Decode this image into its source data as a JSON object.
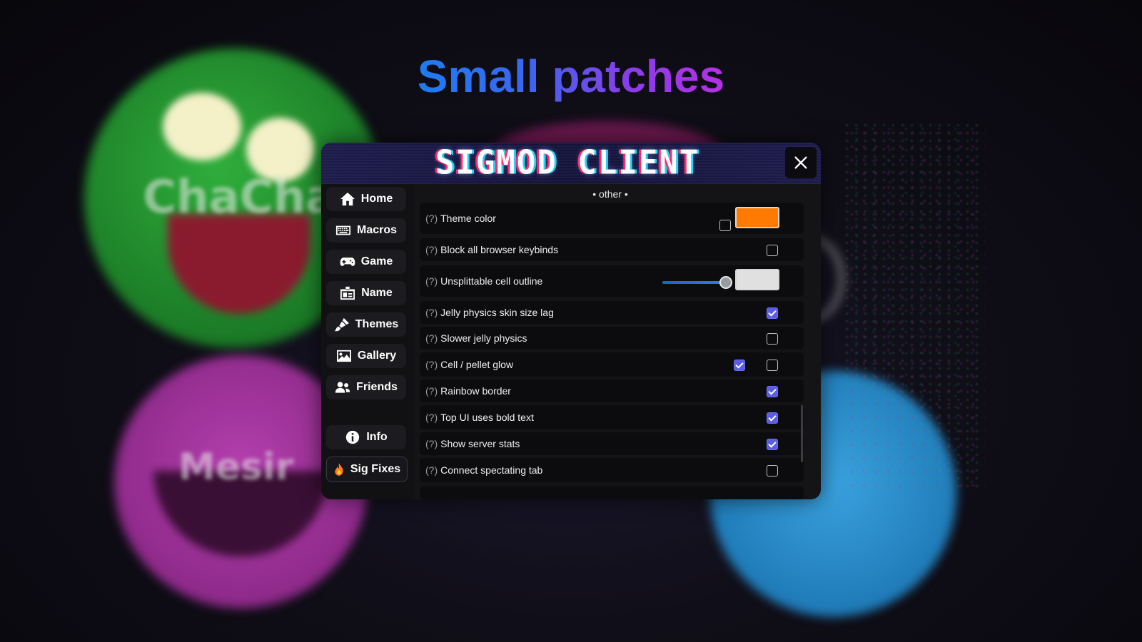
{
  "headline": "Small patches",
  "background_text": {
    "top_left": "ChaCha",
    "bottom_left": "Mesir"
  },
  "modal": {
    "logo_text": "SIGMOD CLIENT",
    "close_icon": "close-icon"
  },
  "sidebar": {
    "items": [
      {
        "label": "Home",
        "icon": "home-icon"
      },
      {
        "label": "Macros",
        "icon": "keyboard-icon"
      },
      {
        "label": "Game",
        "icon": "gamepad-icon"
      },
      {
        "label": "Name",
        "icon": "id-card-icon"
      },
      {
        "label": "Themes",
        "icon": "paint-brush-icon"
      },
      {
        "label": "Gallery",
        "icon": "image-icon"
      },
      {
        "label": "Friends",
        "icon": "users-icon"
      }
    ],
    "info": {
      "label": "Info",
      "icon": "info-icon"
    },
    "sig_fixes": {
      "label": "Sig Fixes",
      "icon": "fire-icon"
    }
  },
  "content": {
    "section_title": "• other •",
    "help_marker": "(?)",
    "settings": [
      {
        "label": "Theme color",
        "checkbox": false,
        "color": "#ff7a00"
      },
      {
        "label": "Block all browser keybinds",
        "checkbox": false
      },
      {
        "label": "Unsplittable cell outline",
        "slider_value": 0.99,
        "color": "#e0e0e0"
      },
      {
        "label": "Jelly physics skin size lag",
        "checkbox": true
      },
      {
        "label": "Slower jelly physics",
        "checkbox": false
      },
      {
        "label": "Cell / pellet glow",
        "checkbox_a": true,
        "checkbox": false
      },
      {
        "label": "Rainbow border",
        "checkbox": true
      },
      {
        "label": "Top UI uses bold text",
        "checkbox": true
      },
      {
        "label": "Show server stats",
        "checkbox": true
      },
      {
        "label": "Connect spectating tab",
        "checkbox": false
      }
    ]
  },
  "colors": {
    "accent": "#5b5de8",
    "headline_gradient_start": "#1d7cf0",
    "headline_gradient_end": "#b530e5"
  }
}
